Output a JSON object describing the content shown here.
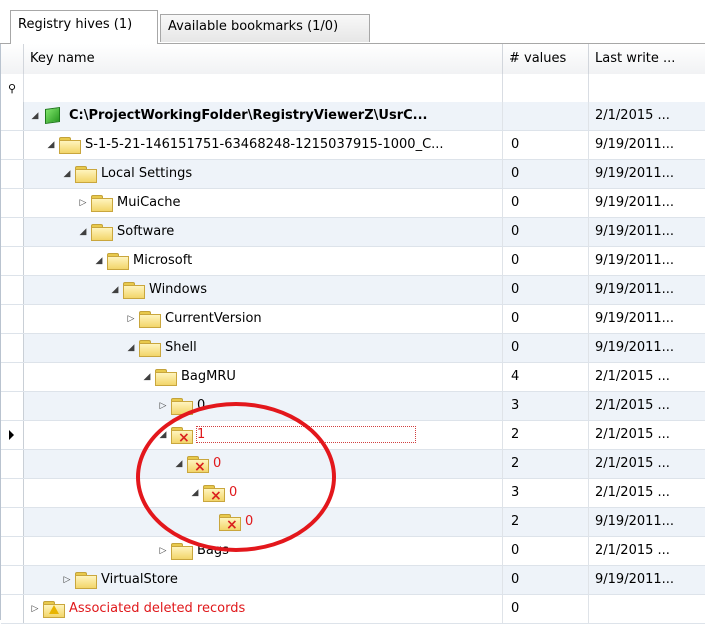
{
  "tabs": [
    {
      "label": "Registry hives (1)",
      "active": true
    },
    {
      "label": "Available bookmarks (1/0)",
      "active": false
    }
  ],
  "columns": {
    "key": "Key name",
    "values": "# values",
    "last_write": "Last write ..."
  },
  "rows": [
    {
      "label": "C:\\ProjectWorkingFolder\\RegistryViewerZ\\UsrC...",
      "values": "",
      "last_write": "2/1/2015 ...",
      "icon": "hive-icon",
      "expanded": true,
      "bold": true
    },
    {
      "label": "S-1-5-21-146151751-63468248-1215037915-1000_C...",
      "values": "0",
      "last_write": "9/19/2011...",
      "icon": "folder-icon",
      "expanded": true
    },
    {
      "label": "Local Settings",
      "values": "0",
      "last_write": "9/19/2011...",
      "icon": "folder-icon",
      "expanded": true
    },
    {
      "label": "MuiCache",
      "values": "0",
      "last_write": "9/19/2011...",
      "icon": "folder-icon",
      "expanded": false
    },
    {
      "label": "Software",
      "values": "0",
      "last_write": "9/19/2011...",
      "icon": "folder-icon",
      "expanded": true
    },
    {
      "label": "Microsoft",
      "values": "0",
      "last_write": "9/19/2011...",
      "icon": "folder-icon",
      "expanded": true
    },
    {
      "label": "Windows",
      "values": "0",
      "last_write": "9/19/2011...",
      "icon": "folder-icon",
      "expanded": true
    },
    {
      "label": "CurrentVersion",
      "values": "0",
      "last_write": "9/19/2011...",
      "icon": "folder-icon",
      "expanded": false
    },
    {
      "label": "Shell",
      "values": "0",
      "last_write": "9/19/2011...",
      "icon": "folder-icon",
      "expanded": true
    },
    {
      "label": "BagMRU",
      "values": "4",
      "last_write": "2/1/2015 ...",
      "icon": "folder-icon",
      "expanded": true
    },
    {
      "label": "0",
      "values": "3",
      "last_write": "2/1/2015 ...",
      "icon": "folder-icon",
      "expanded": false
    },
    {
      "label": "1",
      "values": "2",
      "last_write": "2/1/2015 ...",
      "icon": "deleted-folder-icon",
      "expanded": true,
      "deleted": true,
      "current": true
    },
    {
      "label": "0",
      "values": "2",
      "last_write": "2/1/2015 ...",
      "icon": "deleted-folder-icon",
      "expanded": true,
      "deleted": true
    },
    {
      "label": "0",
      "values": "3",
      "last_write": "2/1/2015 ...",
      "icon": "deleted-folder-icon",
      "expanded": true,
      "deleted": true
    },
    {
      "label": "0",
      "values": "2",
      "last_write": "9/19/2011...",
      "icon": "deleted-folder-icon",
      "expanded": null,
      "deleted": true
    },
    {
      "label": "Bags",
      "values": "0",
      "last_write": "2/1/2015 ...",
      "icon": "folder-icon",
      "expanded": false
    },
    {
      "label": "VirtualStore",
      "values": "0",
      "last_write": "9/19/2011...",
      "icon": "folder-icon",
      "expanded": false
    },
    {
      "label": "Associated deleted records",
      "values": "0",
      "last_write": "",
      "icon": "warning-folder-icon",
      "expanded": false,
      "deleted": true
    }
  ],
  "colors": {
    "deleted_text": "#e0181b",
    "callout": "#e3171c",
    "alt_row": "#eef3f9"
  }
}
